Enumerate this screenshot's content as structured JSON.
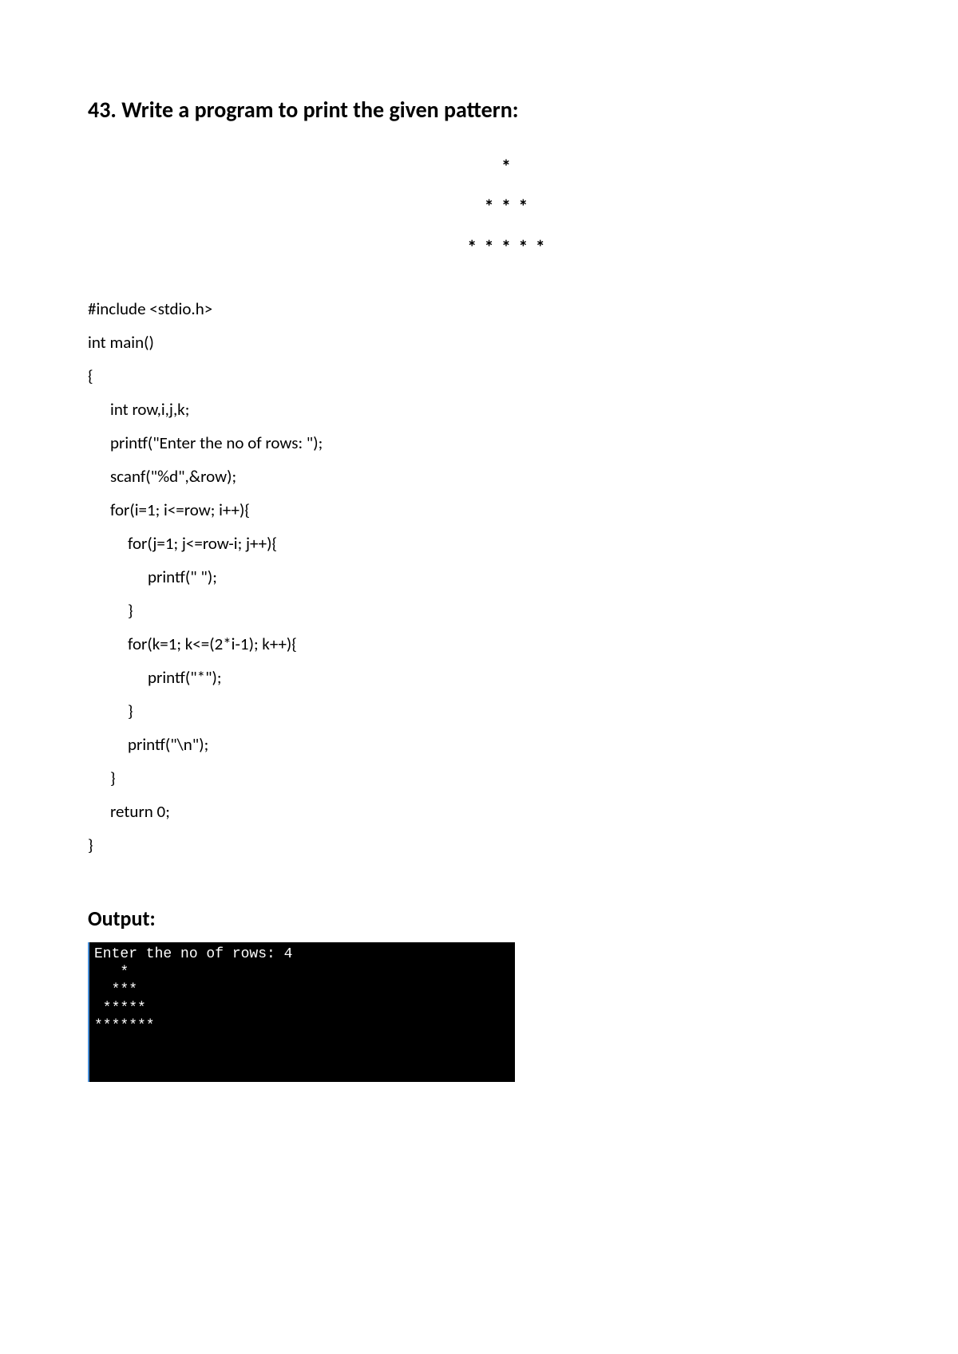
{
  "heading": "43. Write a program to print the given pattern:",
  "pattern": {
    "line1": "*",
    "line2": "* * *",
    "line3": "* * * * *"
  },
  "code": {
    "l1": "#include <stdio.h>",
    "l2": "int main()",
    "l3": "{",
    "l4": "int row,i,j,k;",
    "l5": "printf(\"Enter the no of rows: \");",
    "l6": "scanf(\"%d\",&row);",
    "l7": "for(i=1; i<=row; i++){",
    "l8": "for(j=1; j<=row-i; j++){",
    "l9": "printf(\" \");",
    "l10": "}",
    "l11": "for(k=1; k<=(2*i-1); k++){",
    "l12": "printf(\"*\");",
    "l13": "}",
    "l14": "printf(\"\\n\");",
    "l15": "}",
    "l16": "return 0;",
    "l17": "}"
  },
  "output_heading": "Output:",
  "terminal": "Enter the no of rows: 4\n   *\n  ***\n *****\n*******\n"
}
